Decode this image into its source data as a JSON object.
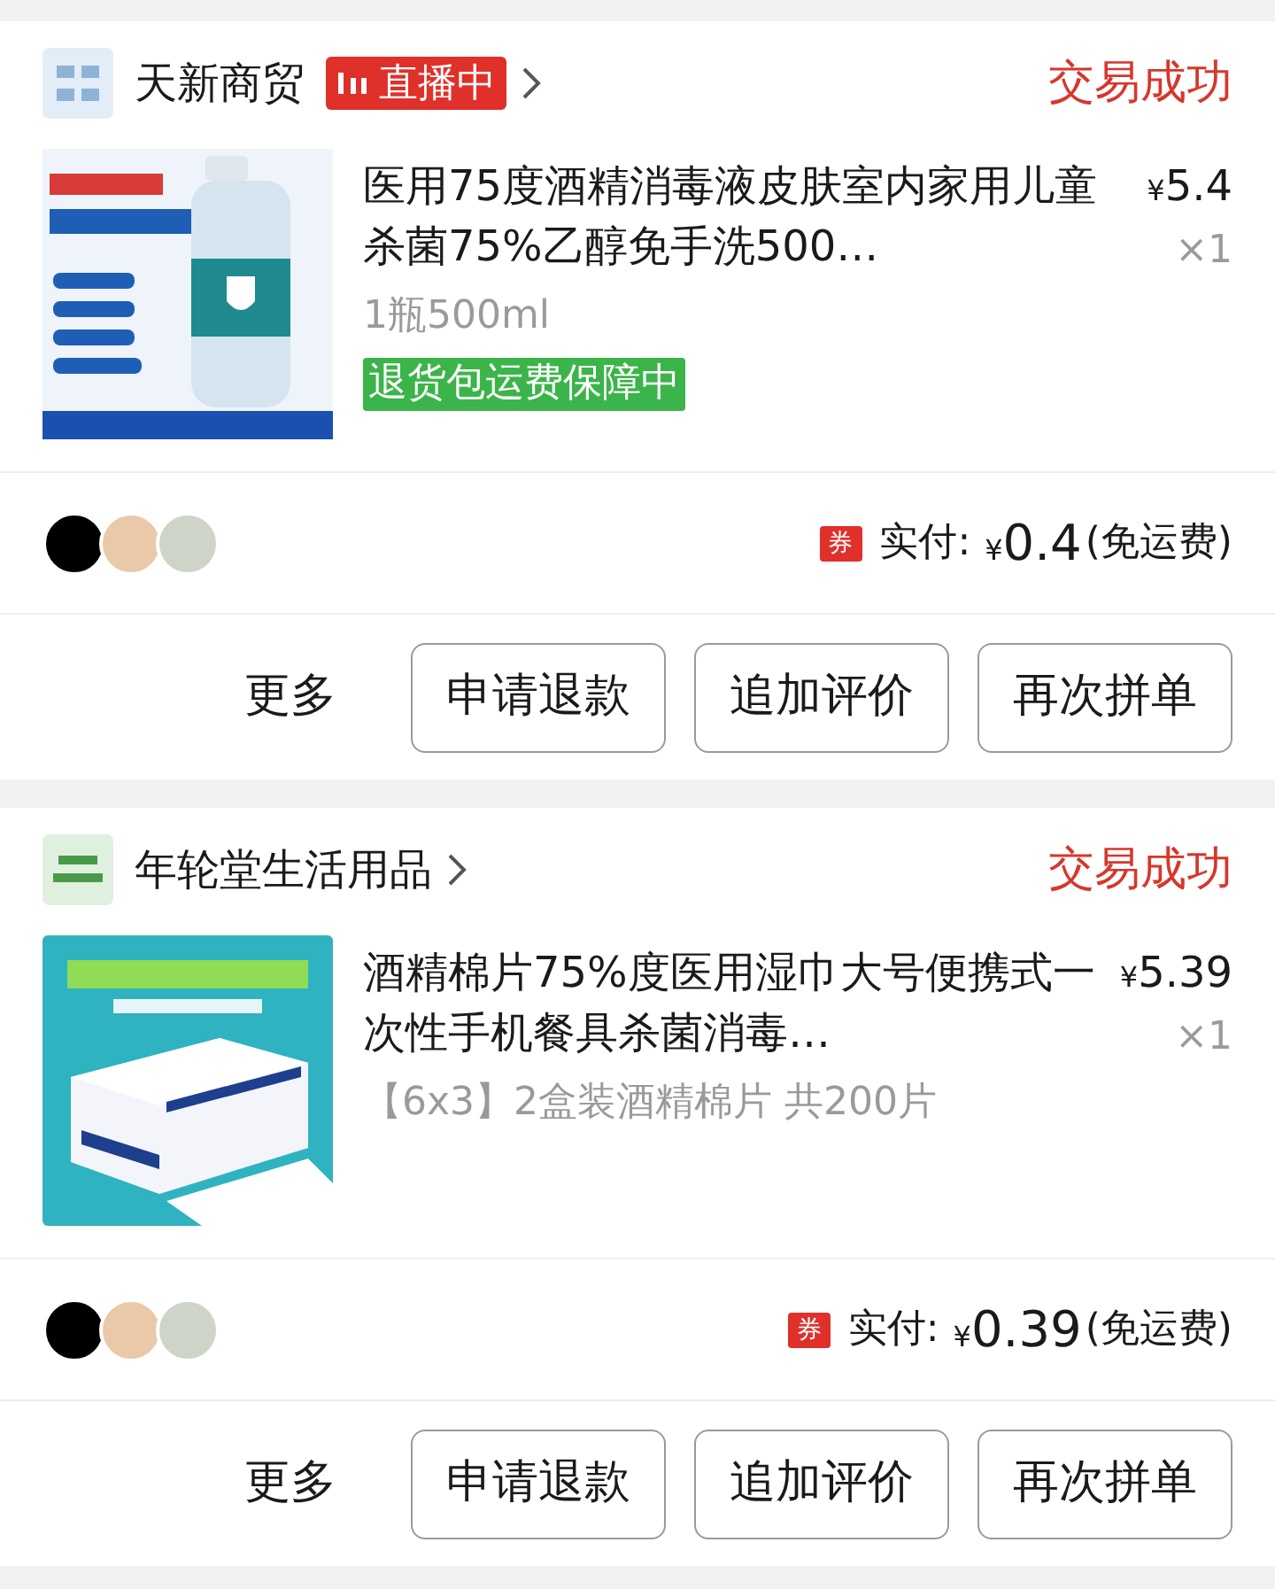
{
  "orders": [
    {
      "shop": {
        "name": "天新商贸",
        "live_badge": "直播中"
      },
      "status": "交易成功",
      "item": {
        "title": "医用75度酒精消毒液皮肤室内家用儿童杀菌75%乙醇免手洗500…",
        "currency": "¥",
        "price": "5.4",
        "quantity": "×1",
        "spec": "1瓶500ml",
        "guarantee": "退货包运费保障中"
      },
      "coupon_badge": "券",
      "paid_label": "实付:",
      "paid_currency": "¥",
      "paid_amount": "0.4",
      "shipping": "(免运费)",
      "actions": [
        "更多",
        "申请退款",
        "追加评价",
        "再次拼单"
      ]
    },
    {
      "shop": {
        "name": "年轮堂生活用品"
      },
      "status": "交易成功",
      "item": {
        "title": "酒精棉片75%度医用湿巾大号便携式一次性手机餐具杀菌消毒…",
        "currency": "¥",
        "price": "5.39",
        "quantity": "×1",
        "spec": "【6x3】2盒装酒精棉片 共200片"
      },
      "coupon_badge": "券",
      "paid_label": "实付:",
      "paid_currency": "¥",
      "paid_amount": "0.39",
      "shipping": "(免运费)",
      "actions": [
        "更多",
        "申请退款",
        "追加评价",
        "再次拼单"
      ]
    }
  ]
}
